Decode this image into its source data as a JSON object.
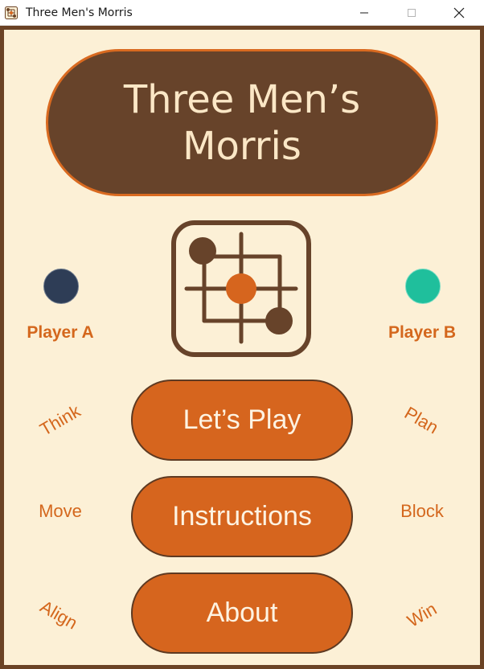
{
  "window": {
    "title": "Three Men's Morris",
    "controls": {
      "minimize_icon": "minimize-icon",
      "maximize_icon": "maximize-icon",
      "close_icon": "close-icon"
    }
  },
  "header": {
    "title": "Three Men’s Morris"
  },
  "logo": {
    "icon": "morris-board-icon"
  },
  "players": [
    {
      "label": "Player A",
      "color": "#2e3d56"
    },
    {
      "label": "Player B",
      "color": "#1fbf9c"
    }
  ],
  "menu": {
    "play_label": "Let’s Play",
    "instructions_label": "Instructions",
    "about_label": "About"
  },
  "side_words": {
    "left": [
      "Think",
      "Move",
      "Align"
    ],
    "right": [
      "Plan",
      "Block",
      "Win"
    ]
  },
  "colors": {
    "frame": "#6b4325",
    "background": "#fcf0d6",
    "title_pill": "#67432a",
    "accent": "#d6651e"
  }
}
